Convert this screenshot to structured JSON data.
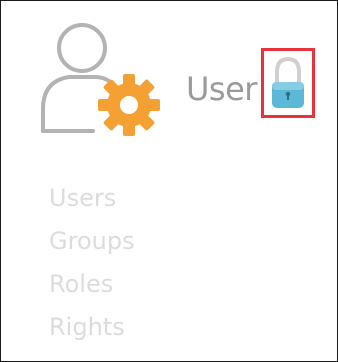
{
  "header": {
    "title": "User",
    "icon": "user-gear-icon",
    "lock_icon": "lock-icon"
  },
  "nav": {
    "items": [
      {
        "label": "Users"
      },
      {
        "label": "Groups"
      },
      {
        "label": "Roles"
      },
      {
        "label": "Rights"
      }
    ]
  },
  "colors": {
    "gear": "#f5a033",
    "outline": "#b3b3b3",
    "lock_body": "#5bb8d6",
    "highlight_border": "#e8333d",
    "nav_text": "#dcdcdc",
    "title_text": "#9a9a9a"
  }
}
